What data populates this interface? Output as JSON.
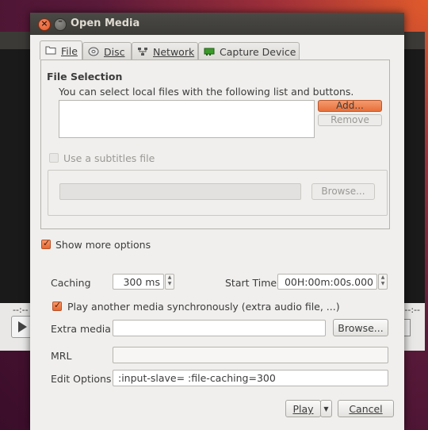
{
  "background_window": {
    "timecode_left": "--:--",
    "timecode_right": "--:--"
  },
  "window": {
    "title": "Open Media"
  },
  "tabs": [
    {
      "label": "File",
      "icon": "folder-icon",
      "active": true
    },
    {
      "label": "Disc",
      "icon": "disc-icon",
      "active": false
    },
    {
      "label": "Network",
      "icon": "network-icon",
      "active": false
    },
    {
      "label": "Capture Device",
      "icon": "capture-card-icon",
      "active": false
    }
  ],
  "file_selection": {
    "title": "File Selection",
    "description": "You can select local files with the following list and buttons.",
    "add_label": "Add...",
    "remove_label": "Remove"
  },
  "subtitles": {
    "checkbox_label": "Use a subtitles file",
    "checked": false,
    "browse_label": "Browse..."
  },
  "show_more": {
    "label": "Show more options",
    "checked": true
  },
  "options": {
    "caching_label": "Caching",
    "caching_value": "300 ms",
    "start_time_label": "Start Time",
    "start_time_value": "00H:00m:00s.000",
    "sync_label": "Play another media synchronously (extra audio file, ...)",
    "sync_checked": true,
    "extra_media_label": "Extra media",
    "extra_media_value": "",
    "extra_browse_label": "Browse...",
    "mrl_label": "MRL",
    "mrl_value": "",
    "edit_options_label": "Edit Options",
    "edit_options_value": ":input-slave= :file-caching=300"
  },
  "footer": {
    "play_label": "Play",
    "cancel_label": "Cancel"
  },
  "colors": {
    "accent": "#e9703b",
    "titlebar": "#3c3b37",
    "dialog_bg": "#f0efed"
  }
}
